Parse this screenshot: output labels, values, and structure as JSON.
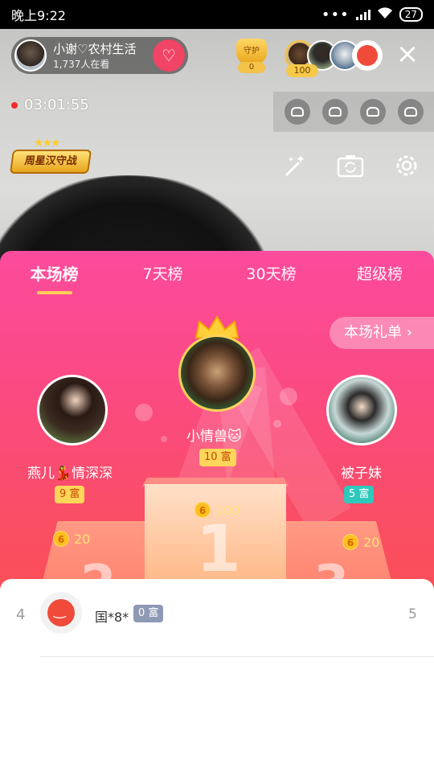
{
  "status_bar": {
    "time": "晚上9:22",
    "battery": "27"
  },
  "host": {
    "name": "小谢♡农村生活",
    "viewers": "1,737人在看"
  },
  "guard": {
    "label": "守护",
    "count": "0"
  },
  "top_viewer_count": "100",
  "stream_timer": "03:01:55",
  "week_badge": {
    "label": "周星汉守战"
  },
  "tabs": [
    {
      "label": "本场榜",
      "active": true
    },
    {
      "label": "7天榜",
      "active": false
    },
    {
      "label": "30天榜",
      "active": false
    },
    {
      "label": "超级榜",
      "active": false
    }
  ],
  "gift_list_button": "本场礼单 ›",
  "podium": {
    "first": {
      "name": "小情兽🐱",
      "rich": "10 富",
      "coins": "100",
      "rank": "1"
    },
    "second": {
      "name": "燕儿💃情深深",
      "rich": "9 富",
      "coins": "20",
      "rank": "2"
    },
    "third": {
      "name": "被子妹",
      "rich": "5 富",
      "coins": "20",
      "rank": "3"
    }
  },
  "list": [
    {
      "rank": "4",
      "name": "国*8*",
      "rich": "0 富",
      "value": "5"
    }
  ],
  "colors": {
    "accent_pink": "#fb4b9c",
    "accent_red": "#fa4f58",
    "gold": "#ffd35a",
    "teal": "#2ec8bc"
  }
}
